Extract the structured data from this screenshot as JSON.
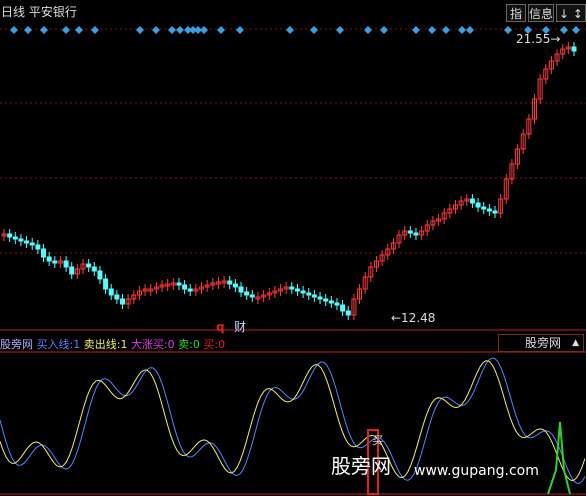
{
  "header": {
    "title": "日线  平安银行",
    "buttons": [
      "指",
      "信息",
      "↓ ↕"
    ]
  },
  "price_labels": {
    "high": "21.55→",
    "low": "←12.48"
  },
  "markers": {
    "q": "q",
    "cai": "财"
  },
  "indicator": {
    "name": "股旁网",
    "buy_line": {
      "label": "买入线:",
      "value": "1",
      "color": "#5a82ff"
    },
    "sell_line": {
      "label": "卖出线:",
      "value": "1",
      "color": "#f0f070"
    },
    "big_rise": {
      "label": "大涨买:",
      "value": "0",
      "color": "#e040e0"
    },
    "sell": {
      "label": "卖:",
      "value": "0",
      "color": "#30d030"
    },
    "buy": {
      "label": "买:",
      "value": "0",
      "color": "#e02020"
    },
    "dropdown_value": "股旁网",
    "signal_text": "买"
  },
  "watermark": {
    "brand": "股旁网",
    "url": "www.gupang.com"
  },
  "colors": {
    "up": "#ff3a3a",
    "down": "#54ffff",
    "grid": "#8a1010",
    "diamond": "#3aa0e0"
  }
}
